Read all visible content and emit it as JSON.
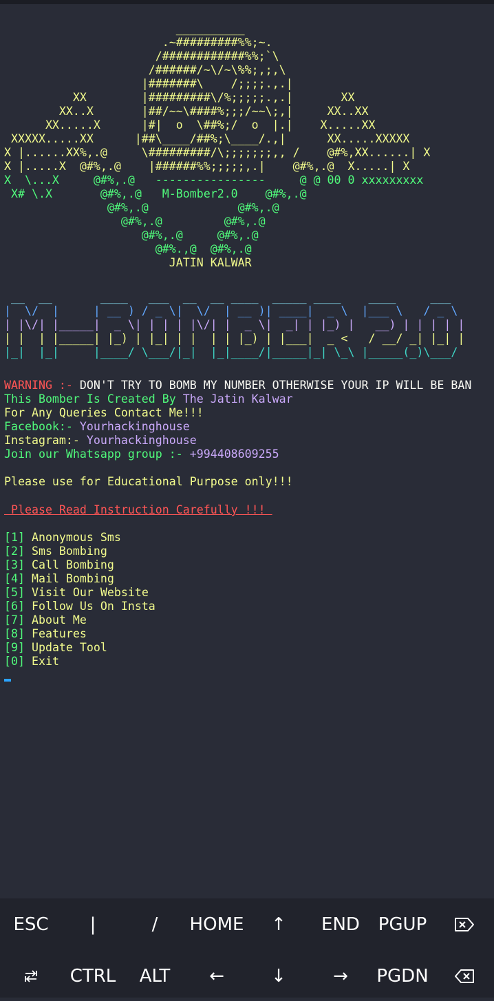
{
  "terminal": {
    "skull": [
      "                         __________",
      "                       .~#########%%;~.",
      "                      /############%%;`\\",
      "                     /######/~\\/~\\%%;,;,\\",
      "                    |#######\\    /;;;;.,.|",
      "          XX        |#########\\/%;;;;;.,.|       XX",
      "        XX..X       |##/~~\\####%;;;/~~\\;,|     XX..XX",
      "      XX.....X      |#|  o  \\##%;/  o  |.|    X.....XX",
      " XXXXX.....XX      |##\\____/##%;\\____/.,|      XX.....XXXXX",
      "X |......XX%,.@     \\#########/\\;;;;;;;,, /    @#%,XX......| X",
      "X |.....X  @#%,.@    |######%%;;;;;,.|    @#%,.@  X.....| X",
      "X  \\...X     @#%,.@   ----------------     @ @ 00 0 xxxxxxxxx",
      " X# \\.X       @#%,.@   M-Bomber2.0    @#%,.@",
      "               @#%,.@             @#%,.@",
      "                 @#%,.@         @#%,.@",
      "                    @#%,.@     @#%,.@",
      "                      @#%.,@  @#%,.@",
      "                        JATIN KALWAR"
    ],
    "banner": [
      " __  __       ____   ___  __  __ ____  _____ ____    ____     ___",
      "|  \\/  |     | __ ) / _ \\|  \\/  | __ )| ____|  _ \\  |___ \\   / _ \\",
      "| |\\/| |_____|  _ \\| | | | |\\/| |  _ \\|  _| | |_) |   __) | | | | |",
      "| |  | |_____| |_) | |_| | |  | | |_) | |___|  _ <   / __/ _| |_| |",
      "|_|  |_|     |____/ \\___/|_|  |_|____/|_____|_| \\_\\ |_____(_)\\___/"
    ],
    "warning_label": "WARNING :-",
    "warning_text": " DON'T TRY TO BOMB MY NUMBER OTHERWISE YOUR IP WILL BE BAN",
    "created_by_label": "This Bomber Is Created By",
    "created_by_name": " The Jatin Kalwar",
    "queries": "For Any Queries Contact Me!!!",
    "facebook_label": "Facebook:-",
    "facebook_value": " Yourhackinghouse",
    "instagram_label": "Instagram:-",
    "instagram_value": " Yourhackinghouse",
    "whatsapp_label": "Join our Whatsapp group :-",
    "whatsapp_value": " +994408609255",
    "educational": "Please use for Educational Purpose only!!!",
    "instruction": " Please Read Instruction Carefully !!! ",
    "menu": [
      {
        "num": "[1]",
        "label": " Anonymous Sms"
      },
      {
        "num": "[2]",
        "label": " Sms Bombing"
      },
      {
        "num": "[3]",
        "label": " Call Bombing"
      },
      {
        "num": "[4]",
        "label": " Mail Bombing"
      },
      {
        "num": "[5]",
        "label": " Visit Our Website"
      },
      {
        "num": "[6]",
        "label": " Follow Us On Insta"
      },
      {
        "num": "[7]",
        "label": " About Me"
      },
      {
        "num": "[8]",
        "label": " Features"
      },
      {
        "num": "[9]",
        "label": " Update Tool"
      },
      {
        "num": "[0]",
        "label": " Exit"
      }
    ]
  },
  "extra_keys": {
    "row1": [
      "ESC",
      "|",
      "/",
      "HOME",
      "↑",
      "END",
      "PGUP"
    ],
    "row1_last_icon": "delete-forward-icon",
    "row2_first_icon": "tab-icon",
    "row2": [
      "CTRL",
      "ALT",
      "←",
      "↓",
      "→",
      "PGDN"
    ],
    "row2_last_icon": "backspace-icon"
  },
  "colors": {
    "background": "#292c37",
    "keyboard_background": "#21232c",
    "skull": "#f1fa8c",
    "ascii_green": "#50fa7b",
    "warning": "#ff5555",
    "highlight": "#caa9fa",
    "menu_number": "#50fa7b",
    "cursor": "#2ba3ff"
  }
}
